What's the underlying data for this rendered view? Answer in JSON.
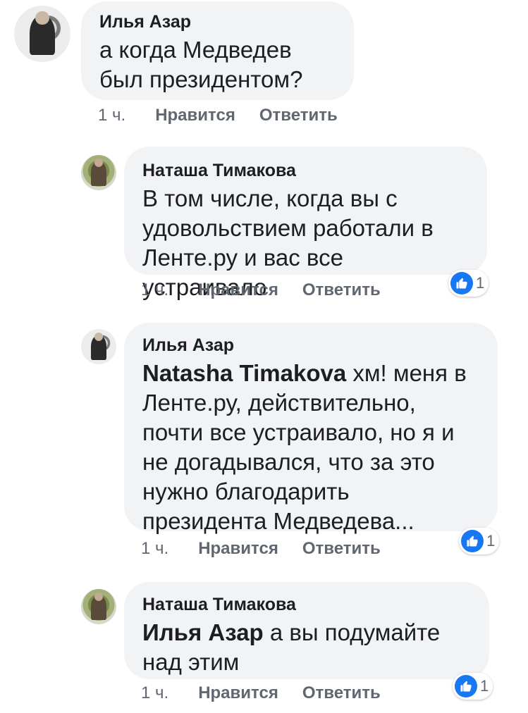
{
  "comments": [
    {
      "author": "Илья Азар",
      "text": "а когда Медведев был президентом?",
      "time": "1 ч.",
      "like_label": "Нравится",
      "reply_label": "Ответить"
    },
    {
      "author": "Наташа Тимакова",
      "text": "В том числе, когда вы с удовольствием работали в Ленте.ру и вас все устраивало",
      "time": "1 ч.",
      "like_label": "Нравится",
      "reply_label": "Ответить",
      "reactions": "1"
    },
    {
      "author": "Илья Азар",
      "mention": "Natasha Timakova",
      "text": " хм! меня в Ленте.ру, действительно, почти все устраивало, но я и не догадывался, что за это нужно благодарить президента Медведева...",
      "time": "1 ч.",
      "like_label": "Нравится",
      "reply_label": "Ответить",
      "reactions": "1"
    },
    {
      "author": "Наташа Тимакова",
      "mention": "Илья Азар",
      "text": " а вы подумайте над этим",
      "time": "1 ч.",
      "like_label": "Нравится",
      "reply_label": "Ответить",
      "reactions": "1"
    }
  ],
  "icons": {
    "like": "thumbs-up-icon",
    "avatar_ilya": "avatar",
    "avatar_natasha": "avatar"
  },
  "colors": {
    "bubble": "#f2f3f5",
    "like_blue": "#1877f2",
    "meta_gray": "#606770"
  }
}
